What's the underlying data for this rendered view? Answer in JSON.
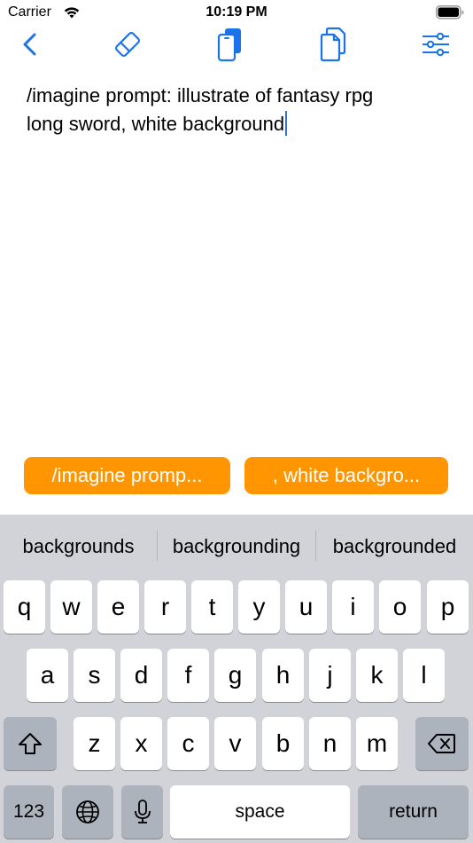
{
  "status_bar": {
    "carrier": "Carrier",
    "time": "10:19 PM",
    "battery_level": 1.0
  },
  "toolbar": {
    "icons": [
      "back-chevron-icon",
      "eraser-icon",
      "phone-copy-icon",
      "duplicate-pages-icon",
      "sliders-icon"
    ],
    "accent_color": "#1a73e8"
  },
  "editor": {
    "text_line_1": "/imagine prompt: illustrate of fantasy rpg",
    "text_line_2": "long sword, white background"
  },
  "snippets": [
    {
      "label": "/imagine promp..."
    },
    {
      "label": ", white backgro..."
    }
  ],
  "snippet_color": "#ff9500",
  "keyboard": {
    "suggestions": [
      "backgrounds",
      "backgrounding",
      "backgrounded"
    ],
    "row1": [
      "q",
      "w",
      "e",
      "r",
      "t",
      "y",
      "u",
      "i",
      "o",
      "p"
    ],
    "row2": [
      "a",
      "s",
      "d",
      "f",
      "g",
      "h",
      "j",
      "k",
      "l"
    ],
    "row3": [
      "z",
      "x",
      "c",
      "v",
      "b",
      "n",
      "m"
    ],
    "numbers_label": "123",
    "space_label": "space",
    "return_label": "return"
  }
}
